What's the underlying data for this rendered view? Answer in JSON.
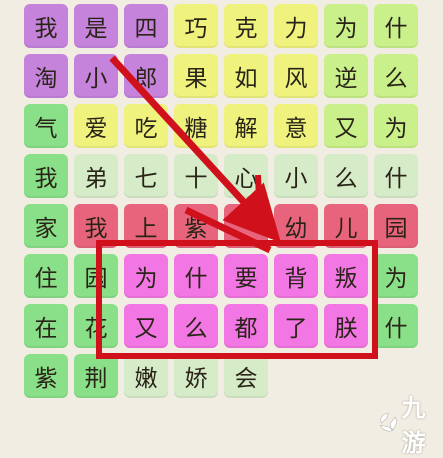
{
  "puzzle": {
    "grid_rows": [
      [
        "我",
        "是",
        "四",
        "巧",
        "克",
        "力",
        "为",
        "什"
      ],
      [
        "淘",
        "小",
        "郎",
        "果",
        "如",
        "风",
        "逆",
        "么"
      ],
      [
        "气",
        "爱",
        "吃",
        "糖",
        "解",
        "意",
        "又",
        "为"
      ],
      [
        "我",
        "弟",
        "七",
        "十",
        "心",
        "小",
        "么",
        "什"
      ],
      [
        "家",
        "我",
        "上",
        "紫",
        "",
        "幼",
        "儿",
        "园"
      ],
      [
        "住",
        "园",
        "为",
        "什",
        "要",
        "背",
        "叛",
        "为"
      ],
      [
        "在",
        "花",
        "又",
        "么",
        "都",
        "了",
        "朕",
        "什"
      ],
      [
        "紫",
        "荆",
        "嫩",
        "娇",
        "会",
        "",
        "",
        ""
      ]
    ],
    "cell_colors": [
      [
        "#c583dc",
        "#c583dc",
        "#c583dc",
        "#f0f27e",
        "#f0f27e",
        "#f0f27e",
        "#c9f08a",
        "#c9f08a"
      ],
      [
        "#c583dc",
        "#c583dc",
        "#c583dc",
        "#f0f27e",
        "#f0f27e",
        "#f0f27e",
        "#c9f08a",
        "#c9f08a"
      ],
      [
        "#89e089",
        "#f0f27e",
        "#f0f27e",
        "#f0f27e",
        "#f0f27e",
        "#f0f27e",
        "#c9f08a",
        "#c9f08a"
      ],
      [
        "#89e089",
        "#d6ecc9",
        "#d6ecc9",
        "#d6ecc9",
        "#d6ecc9",
        "#d6ecc9",
        "#d6ecc9",
        "#d6ecc9"
      ],
      [
        "#89e089",
        "#e8647c",
        "#e8647c",
        "#e8647c",
        "#e8647c",
        "#e8647c",
        "#e8647c",
        "#e8647c"
      ],
      [
        "#89e089",
        "#89e089",
        "#f276e3",
        "#f276e3",
        "#f276e3",
        "#f276e3",
        "#f276e3",
        "#89e089"
      ],
      [
        "#89e089",
        "#89e089",
        "#f276e3",
        "#f276e3",
        "#f276e3",
        "#f276e3",
        "#f276e3",
        "#89e089"
      ],
      [
        "#89e089",
        "#89e089",
        "#d6ecc9",
        "#d6ecc9",
        "#d6ecc9",
        "",
        "",
        ""
      ]
    ],
    "highlight_color": "#d0101a",
    "arrow_color": "#d0101a"
  },
  "watermark": {
    "text": "九游",
    "logo_icon": "jiuyou-logo-icon"
  }
}
